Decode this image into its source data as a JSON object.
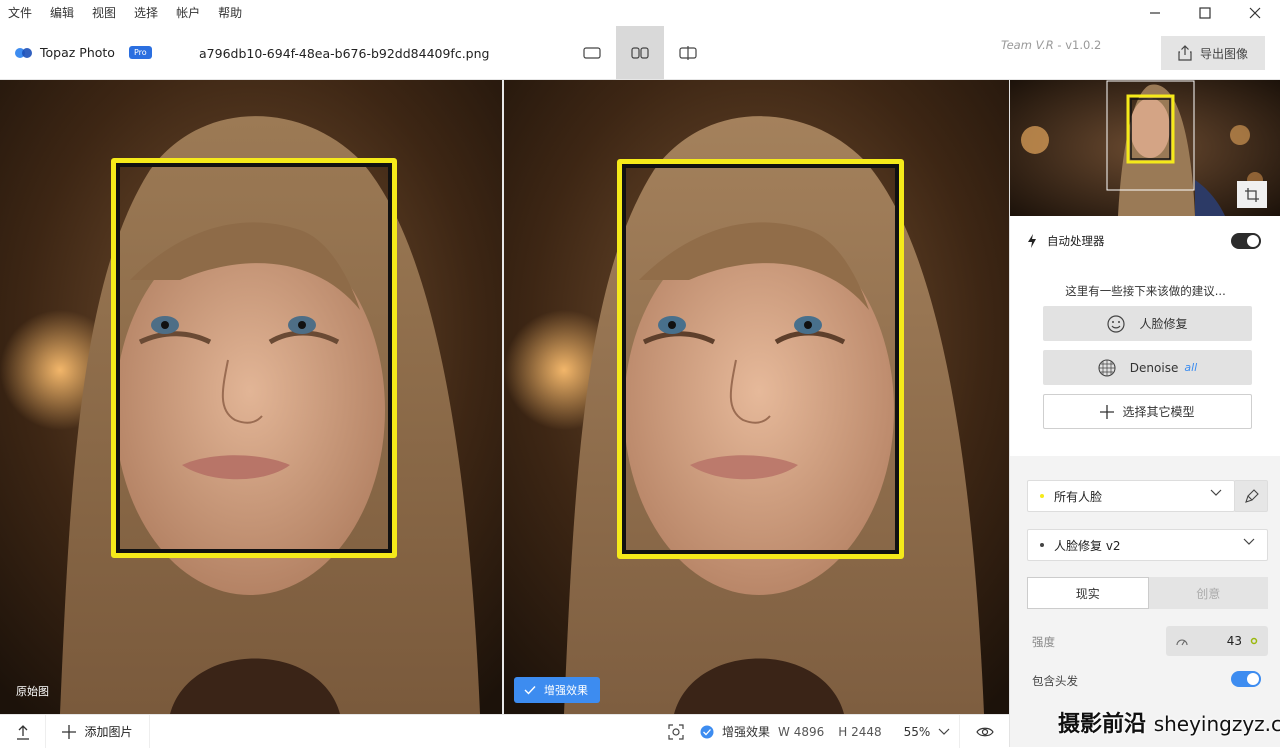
{
  "menu": [
    "文件",
    "编辑",
    "视图",
    "选择",
    "帐户",
    "帮助"
  ],
  "app": {
    "name": "Topaz Photo",
    "badge": "Pro"
  },
  "file": {
    "name": "a796db10-694f-48ea-b676-b92dd84409fc.png"
  },
  "version": {
    "team": "Team V.R",
    "sep": " - ",
    "number": "v1.0.2"
  },
  "toolbar": {
    "export_label": "导出图像",
    "active_view": "side-by-side"
  },
  "viewer": {
    "original_label": "原始图",
    "enhanced_label": "增强效果"
  },
  "status": {
    "add_image": "添加图片",
    "effect_label": "增强效果",
    "width": "W 4896",
    "height": "H 2448",
    "zoom": "55%"
  },
  "panel": {
    "auto_label": "自动处理器",
    "auto_on": true,
    "suggest_text": "这里有一些接下来该做的建议...",
    "suggestions": [
      {
        "label": "人脸修复",
        "icon": "smile-icon"
      },
      {
        "label": "Denoise",
        "tag": "all",
        "icon": "grid-globe-icon"
      },
      {
        "label": "选择其它模型",
        "icon": "plus-icon"
      }
    ],
    "face_select": "所有人脸",
    "model_select": "人脸修复 v2",
    "mode_tabs": [
      "现实",
      "创意"
    ],
    "active_mode": "现实",
    "strength_label": "强度",
    "strength_value": "43",
    "hair_label": "包含头发",
    "hair_on": true
  },
  "watermark": {
    "cn": "摄影前沿",
    "url": "sheyingzyz.com"
  },
  "colors": {
    "accent": "#3d8cf0",
    "facebox": "#f5ea1a",
    "toggle_dark": "#2c2c2c"
  }
}
